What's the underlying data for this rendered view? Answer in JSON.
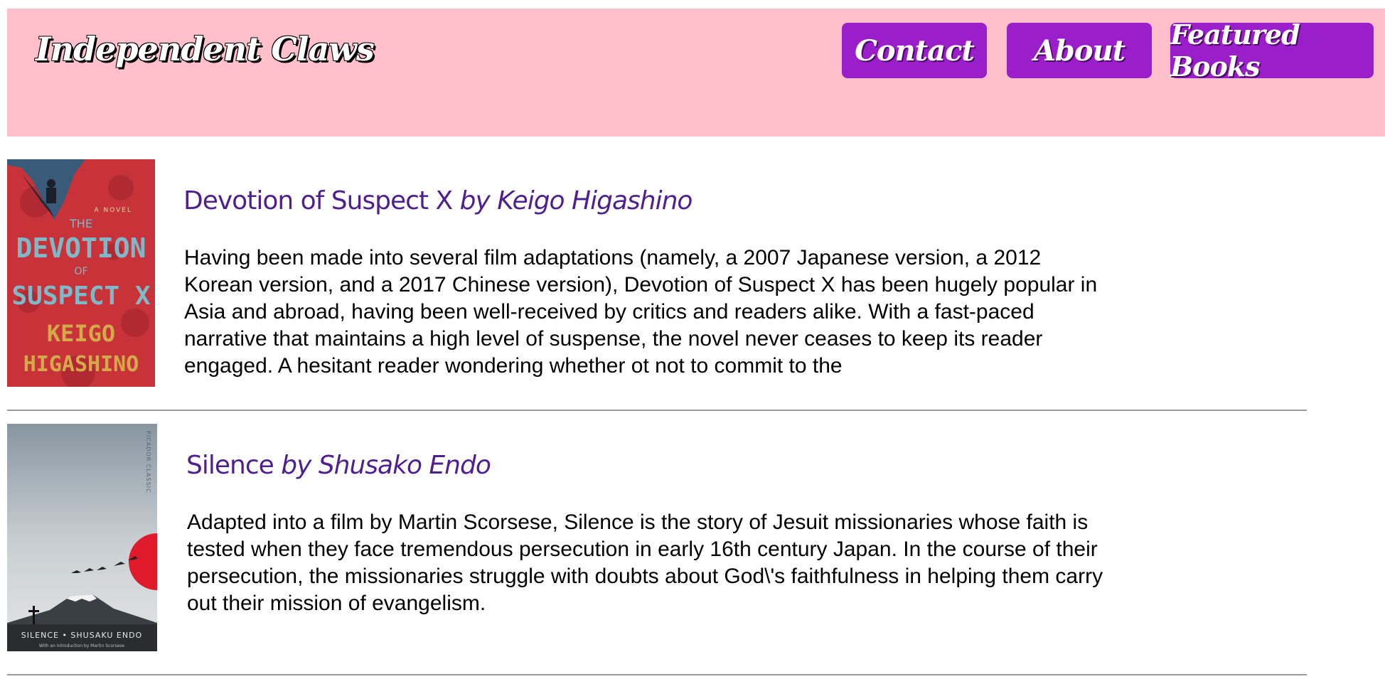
{
  "header": {
    "logo": "Independent Claws",
    "nav": {
      "contact": "Contact",
      "about": "About",
      "featured": "Featured Books"
    }
  },
  "books": [
    {
      "title": "Devotion of Suspect X ",
      "author": "by Keigo Higashino",
      "description": "Having been made into several film adaptations (namely, a 2007 Japanese version, a 2012 Korean version, and a 2017 Chinese version), Devotion of Suspect X has been hugely popular in Asia and abroad, having been well-received by critics and readers alike. With a fast-paced narrative that maintains a high level of suspense, the novel never ceases to keep its reader engaged. A hesitant reader wondering whether ot not to commit to the",
      "cover": {
        "small_text": "A NOVEL",
        "line1": "THE",
        "line2": "DEVOTION",
        "line3": "OF",
        "line4": "SUSPECT X",
        "author1": "KEIGO",
        "author2": "HIGASHINO",
        "bg_color": "#c8333a",
        "title_color": "#7fb8c9",
        "author_color": "#d4a94a"
      }
    },
    {
      "title": "Silence ",
      "author": "by Shusako Endo",
      "description": "Adapted into a film by Martin Scorsese, Silence is the story of Jesuit missionaries whose faith is tested when they face tremendous persecution in early 16th century Japan. In the course of their persecution, the missionaries struggle with doubts about God\\'s faithfulness in helping them carry out their mission of evangelism.",
      "cover": {
        "side_text": "PICADOR CLASSIC",
        "title": "SILENCE • SHUSAKU ENDO",
        "subtitle": "With an introduction by Martin Scorsese",
        "sun_color": "#e01a2a"
      }
    }
  ],
  "colors": {
    "header_bg": "#ffc0cb",
    "nav_bg": "#9a1fca",
    "title_color": "#4f1f8f"
  }
}
